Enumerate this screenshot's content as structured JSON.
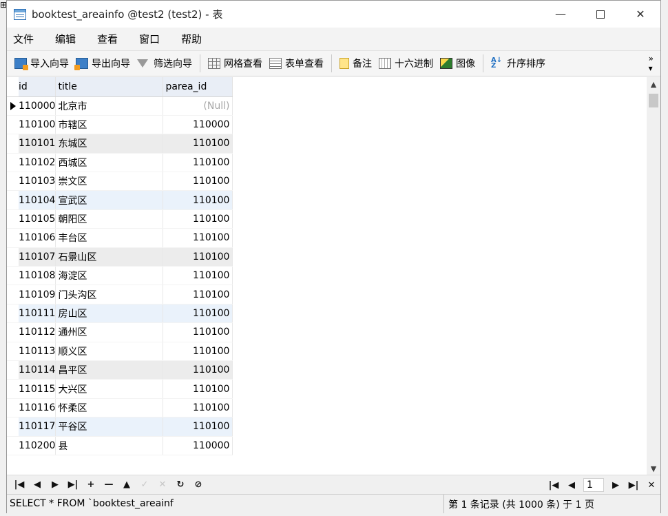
{
  "window": {
    "title": "booktest_areainfo @test2 (test2) - 表",
    "controls": {
      "minimize": "—",
      "close": "✕"
    }
  },
  "menubar": [
    "文件",
    "编辑",
    "查看",
    "窗口",
    "帮助"
  ],
  "toolbar": {
    "import_wizard": "导入向导",
    "export_wizard": "导出向导",
    "filter_wizard": "筛选向导",
    "grid_view": "网格查看",
    "form_view": "表单查看",
    "memo": "备注",
    "hex": "十六进制",
    "image": "图像",
    "sort_asc": "升序排序",
    "more": "»"
  },
  "table": {
    "columns": [
      "id",
      "title",
      "parea_id"
    ],
    "rows": [
      {
        "id": "110000",
        "title": "北京市",
        "parea_id": "(Null)"
      },
      {
        "id": "110100",
        "title": "市辖区",
        "parea_id": "110000"
      },
      {
        "id": "110101",
        "title": "东城区",
        "parea_id": "110100"
      },
      {
        "id": "110102",
        "title": "西城区",
        "parea_id": "110100"
      },
      {
        "id": "110103",
        "title": "崇文区",
        "parea_id": "110100"
      },
      {
        "id": "110104",
        "title": "宣武区",
        "parea_id": "110100"
      },
      {
        "id": "110105",
        "title": "朝阳区",
        "parea_id": "110100"
      },
      {
        "id": "110106",
        "title": "丰台区",
        "parea_id": "110100"
      },
      {
        "id": "110107",
        "title": "石景山区",
        "parea_id": "110100"
      },
      {
        "id": "110108",
        "title": "海淀区",
        "parea_id": "110100"
      },
      {
        "id": "110109",
        "title": "门头沟区",
        "parea_id": "110100"
      },
      {
        "id": "110111",
        "title": "房山区",
        "parea_id": "110100"
      },
      {
        "id": "110112",
        "title": "通州区",
        "parea_id": "110100"
      },
      {
        "id": "110113",
        "title": "顺义区",
        "parea_id": "110100"
      },
      {
        "id": "110114",
        "title": "昌平区",
        "parea_id": "110100"
      },
      {
        "id": "110115",
        "title": "大兴区",
        "parea_id": "110100"
      },
      {
        "id": "110116",
        "title": "怀柔区",
        "parea_id": "110100"
      },
      {
        "id": "110117",
        "title": "平谷区",
        "parea_id": "110100"
      },
      {
        "id": "110200",
        "title": "县",
        "parea_id": "110000"
      }
    ]
  },
  "navigation": {
    "first": "|◀",
    "prev": "◀",
    "next": "▶",
    "last": "▶|",
    "add": "+",
    "delete": "—",
    "up": "▲",
    "apply": "✓",
    "cancel": "✕",
    "refresh": "↻",
    "stop": "⊘",
    "page_first": "|◀",
    "page_prev": "◀",
    "page_number": "1",
    "page_next": "▶",
    "page_last": "▶|",
    "settings": "✕"
  },
  "status": {
    "sql": "SELECT * FROM `booktest_areainf",
    "record_info": "第 1 条记录 (共 1000 条) 于 1 页"
  }
}
